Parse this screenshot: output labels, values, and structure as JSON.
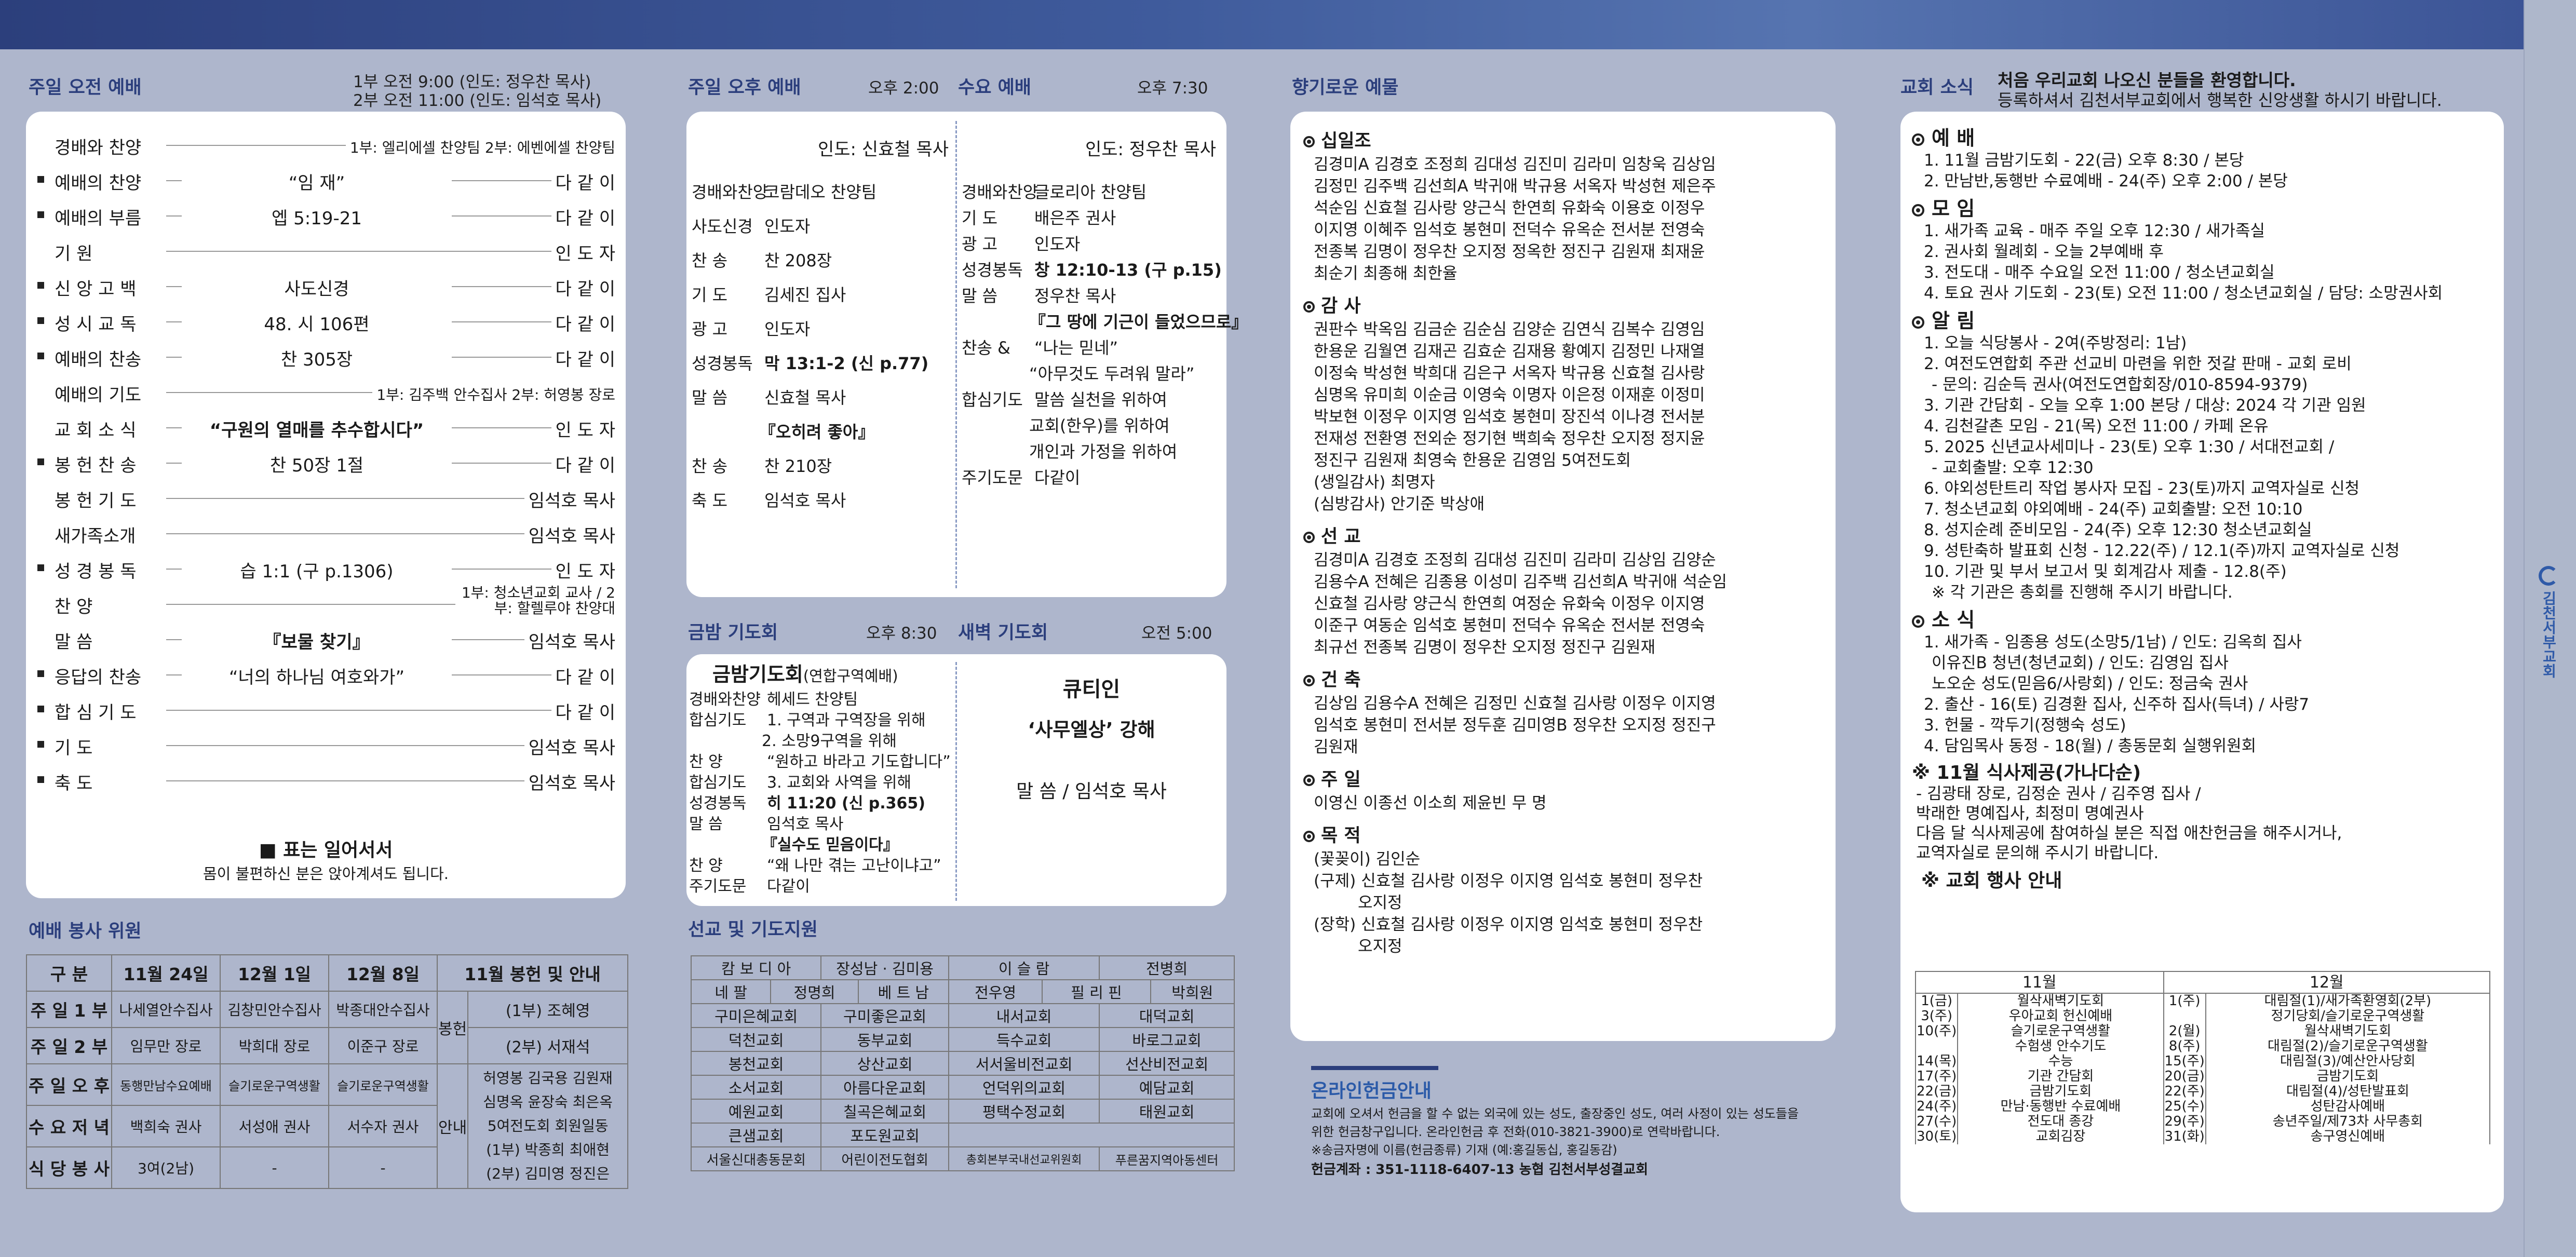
{
  "morning": {
    "title": "주일 오전 예배",
    "time1": "1부 오전  9:00 (인도: 정우찬 목사)",
    "time2": "2부 오전 11:00 (인도: 임석호 목사)",
    "rows": [
      {
        "l": "경배와 찬양",
        "m": "",
        "r": "1부: 엘리에셀 찬양팀 2부: 에벤에셀 찬양팀"
      },
      {
        "l": "예배의 찬양",
        "m": "“임 재”",
        "r": "다 같 이"
      },
      {
        "l": "예배의 부름",
        "m": "엡 5:19-21",
        "r": "다 같 이"
      },
      {
        "l": "기          원",
        "m": "",
        "r": "인 도 자"
      },
      {
        "l": "신 앙 고 백",
        "m": "사도신경",
        "r": "다 같 이"
      },
      {
        "l": "성 시 교 독",
        "m": "48. 시 106편",
        "r": "다 같 이"
      },
      {
        "l": "예배의 찬송",
        "m": "찬 305장",
        "r": "다 같 이"
      },
      {
        "l": "예배의 기도",
        "m": "",
        "r": "1부: 김주백 안수집사 2부: 허영봉 장로"
      },
      {
        "l": "교 회 소 식",
        "m": "“구원의 열매를 추수합시다”",
        "r": "인 도 자"
      },
      {
        "l": "봉 헌 찬 송",
        "m": "찬 50장 1절",
        "r": "다 같 이"
      },
      {
        "l": "봉 헌 기 도",
        "m": "",
        "r": "임석호 목사"
      },
      {
        "l": "새가족소개",
        "m": "",
        "r": "임석호 목사"
      },
      {
        "l": "성 경 봉 독",
        "m": "습 1:1 (구 p.1306)",
        "r": "인 도 자"
      },
      {
        "l": "찬          양",
        "m": "",
        "r": "1부: 청소년교회 교사 / 2부: 할렐루야 찬양대"
      },
      {
        "l": "말          씀",
        "m": "『보물 찾기』",
        "r": "임석호 목사"
      },
      {
        "l": "응답의 찬송",
        "m": "“너의 하나님 여호와가”",
        "r": "다 같 이"
      },
      {
        "l": "합 심 기 도",
        "m": "",
        "r": "다 같 이"
      },
      {
        "l": "기          도",
        "m": "",
        "r": "임석호 목사"
      },
      {
        "l": "축          도",
        "m": "",
        "r": "임석호 목사"
      }
    ],
    "note1": "■ 표는 일어서서",
    "note2": "몸이 불편하신 분은 앉아계셔도 됩니다."
  },
  "service": {
    "title": "예배 봉사 위원",
    "headers": [
      "구 분",
      "11월 24일",
      "12월 1일",
      "12월 8일",
      "11월 봉헌 및 안내"
    ],
    "rows": [
      [
        "주 일 1 부",
        "나세열안수집사",
        "김창민안수집사",
        "박종대안수집사"
      ],
      [
        "주 일 2 부",
        "임무만 장로",
        "박희대 장로",
        "이준구 장로"
      ],
      [
        "주 일 오 후",
        "동행만남수요예배",
        "슬기로운구역생활",
        "슬기로운구역생활"
      ],
      [
        "수 요 저 녁",
        "백희숙 권사",
        "서성애 권사",
        "서수자 권사"
      ],
      [
        "식 당 봉 사",
        "3여(2남)",
        "-",
        "-"
      ]
    ],
    "offer_label1": "봉헌",
    "offer_label2": "안내",
    "offer1": "(1부) 조혜영",
    "offer2": "(2부) 서재석",
    "guide": [
      "허영봉 김국용 김원재",
      "심명옥 윤장숙 최은옥",
      "5여전도회 회원일동",
      "(1부) 박종희 최애현",
      "(2부) 김미영 정진은"
    ]
  },
  "afternoon": {
    "title": "주일 오후 예배",
    "time": "오후 2:00",
    "leader": "인도: 신효철 목사",
    "rows": [
      [
        "경배와찬양",
        "코람데오 찬양팀"
      ],
      [
        "사도신경",
        "인도자"
      ],
      [
        "찬      송",
        "찬 208장"
      ],
      [
        "기      도",
        "김세진 집사"
      ],
      [
        "광      고",
        "인도자"
      ],
      [
        "성경봉독",
        "막 13:1-2 (신 p.77)"
      ],
      [
        "말      씀",
        "신효철 목사"
      ],
      [
        "",
        "『오히려 좋아』"
      ],
      [
        "찬      송",
        "찬 210장"
      ],
      [
        "축      도",
        "임석호 목사"
      ]
    ]
  },
  "wednesday": {
    "title": "수요 예배",
    "time": "오후 7:30",
    "leader": "인도: 정우찬 목사",
    "rows": [
      [
        "경배와찬양",
        "글로리아 찬양팀"
      ],
      [
        "기      도",
        "배은주 권사"
      ],
      [
        "광      고",
        "인도자"
      ],
      [
        "성경봉독",
        "창 12:10-13 (구 p.15)"
      ],
      [
        "말      씀",
        "정우찬 목사"
      ],
      [
        "",
        "『그 땅에 기근이 들었으므로』"
      ],
      [
        "찬송 &",
        "“나는 믿네”"
      ],
      [
        "",
        "“아무것도 두려워 말라”"
      ],
      [
        "합심기도",
        "말씀 실천을 위하여"
      ],
      [
        "",
        "교회(한우)를 위하여"
      ],
      [
        "",
        "개인과 가정을 위하여"
      ],
      [
        "주기도문",
        "다같이"
      ]
    ]
  },
  "friday": {
    "title": "금밤 기도회",
    "time": "오후 8:30",
    "head": "금밤기도회",
    "head_sub": "(연합구역예배)",
    "rows": [
      [
        "경배와찬양",
        "헤세드 찬양팀"
      ],
      [
        "합심기도",
        "1. 구역과 구역장을 위해"
      ],
      [
        "",
        "2. 소망9구역을 위해"
      ],
      [
        "찬      양",
        "“원하고 바라고 기도합니다”"
      ],
      [
        "합심기도",
        "3. 교회와 사역을 위해"
      ],
      [
        "성경봉독",
        "히 11:20 (신 p.365)"
      ],
      [
        "말      씀",
        "임석호 목사"
      ],
      [
        "",
        "『실수도 믿음이다』"
      ],
      [
        "찬      양",
        "“왜 나만 겪는 고난이냐고”"
      ],
      [
        "주기도문",
        "다같이"
      ]
    ]
  },
  "dawn": {
    "title": "새벽 기도회",
    "time": "오전 5:00",
    "head": "큐티인",
    "sub": "‘사무엘상’ 강해",
    "speaker": "말 씀 / 임석호 목사"
  },
  "mission": {
    "title": "선교 및 기도지원",
    "rows": [
      [
        "캄 보 디 아",
        "장성남 · 김미용",
        "이 슬 람",
        "전병희"
      ],
      [
        "네 팔",
        "정명희",
        "베 트 남",
        "전우영",
        "필 리 핀",
        "박희원"
      ],
      [
        "구미은혜교회",
        "구미좋은교회",
        "내서교회",
        "대덕교회"
      ],
      [
        "덕천교회",
        "동부교회",
        "득수교회",
        "바로그교회"
      ],
      [
        "봉천교회",
        "상산교회",
        "서서울비전교회",
        "선산비전교회"
      ],
      [
        "소서교회",
        "아름다운교회",
        "언덕위의교회",
        "예담교회"
      ],
      [
        "예원교회",
        "칠곡은혜교회",
        "평택수정교회",
        "태원교회"
      ],
      [
        "큰샘교회",
        "포도원교회"
      ],
      [
        "서울신대총동문회",
        "어린이전도협회",
        "총회본부국내선교위원회",
        "푸른꿈지역아동센터"
      ]
    ]
  },
  "prayer": {
    "title": "향기로운 예물",
    "sections": [
      {
        "h": "십일조",
        "lines": [
          "김경미A 김경호 조정희 김대성 김진미 김라미 임창욱 김상임",
          "김정민 김주백 김선희A 박귀애 박규용 서옥자 박성현 제은주",
          "석순임 신효철 김사랑 양근식 한연희 유화숙 이용호 이정우",
          "이지영 이혜주 임석호 봉현미 전덕수 유옥순 전서분 전영숙",
          "전종복 김명이 정우찬 오지정 정옥한 정진구 김원재 최재윤",
          "최순기 최종해 최한율"
        ]
      },
      {
        "h": "감 사",
        "lines": [
          "권판수 박옥임 김금순 김순심 김양순 김연식 김복수 김영임",
          "한용운 김월연 김재곤 김효순 김재용 황예지 김정민 나재열",
          "이정숙 박성현 박희대 김은구 서옥자 박규용 신효철 김사랑",
          "심명옥 유미희 이순금 이영숙 이명자 이은정 이재훈 이정미",
          "박보현 이정우 이지영 임석호 봉현미 장진석 이나경 전서분",
          "전재성 전환영 전외순 정기현 백희숙 정우찬 오지정 정지윤",
          "정진구 김원재 최영숙 한용운 김영임 5여전도회",
          "(생일감사) 최명자",
          "(심방감사) 안기준 박상애"
        ]
      },
      {
        "h": "선 교",
        "lines": [
          "김경미A 김경호 조정희 김대성 김진미 김라미 김상임 김양순",
          "김용수A 전혜은 김종용 이성미 김주백 김선희A 박귀애 석순임",
          "신효철 김사랑 양근식 한연희 여정순 유화숙 이정우 이지영",
          "이준구 여동순 임석호 봉현미 전덕수 유옥순 전서분 전영숙",
          "최규선 전종복 김명이 정우찬 오지정 정진구 김원재"
        ]
      },
      {
        "h": "건 축",
        "lines": [
          "김상임 김용수A 전혜은 김정민 신효철 김사랑 이정우 이지영",
          "임석호 봉현미 전서분 정두훈 김미영B 정우찬 오지정 정진구",
          "김원재"
        ]
      },
      {
        "h": "주 일",
        "lines": [
          "이영신 이종선 이소희 제윤빈 무   명"
        ]
      },
      {
        "h": "목 적",
        "lines": [
          "(꽃꽂이) 김인순",
          "(구제) 신효철 김사랑 이정우 이지영 임석호 봉현미 정우찬",
          "오지정",
          "(장학) 신효철 김사랑 이정우 이지영 임석호 봉현미 정우찬",
          "오지정"
        ]
      }
    ],
    "online_title": "온라인헌금안내",
    "online1": "교회에 오셔서 헌금을 할 수 없는 외국에 있는 성도, 출장중인 성도, 여러 사정이 있는 성도들을",
    "online2": "위한 헌금창구입니다. 온라인헌금 후 전화(010-3821-3900)로 연락바랍니다.",
    "online3": "※송금자명에 이름(헌금종류) 기재 (예:홍길동십, 홍길동감)",
    "online4": "헌금계좌 : 351-1118-6407-13 농협 김천서부성결교회"
  },
  "news": {
    "title": "교회 소식",
    "welcome1": "처음 우리교회 나오신 분들을 환영합니다.",
    "welcome2": "등록하셔서 김천서부교회에서 행복한 신앙생활 하시기 바랍니다.",
    "sec_worship": "예  배",
    "worship": [
      "1. 11월 금밤기도회 - 22(금) 오후 8:30 / 본당",
      "2. 만남반,동행반 수료예배 - 24(주) 오후 2:00 / 본당"
    ],
    "sec_meet": "모  임",
    "meet": [
      "1. 새가족 교육 - 매주 주일 오후 12:30 / 새가족실",
      "2. 권사회 월례회 - 오늘 2부예배 후",
      "3. 전도대 - 매주 수요일 오전 11:00 / 청소년교회실",
      "4. 토요 권사 기도회 - 23(토) 오전 11:00 / 청소년교회실 / 담당: 소망권사회"
    ],
    "sec_notice": "알  림",
    "notice": [
      "1. 오늘 식당봉사 - 2여(주방정리: 1남)",
      "2. 여전도연합회 주관 선교비 마련을 위한 젓갈 판매 - 교회 로비",
      "   - 문의: 김순득 권사(여전도연합회장/010-8594-9379)",
      "3. 기관 간담회 - 오늘 오후 1:00 본당 / 대상: 2024 각 기관 임원",
      "4. 김천갈촌 모임 - 21(목) 오전 11:00 / 카페 온유",
      "5. 2025 신년교사세미나 - 23(토) 오후 1:30 / 서대전교회 /",
      "   - 교회출발: 오후 12:30",
      "6. 야외성탄트리 작업 봉사자 모집 - 23(토)까지 교역자실로 신청",
      "7. 청소년교회 야외예배 - 24(주) 교회출발: 오전 10:10",
      "8. 성지순례 준비모임 - 24(주) 오후 12:30 청소년교회실",
      "9. 성탄축하 발표회 신청 - 12.22(주) / 12.1(주)까지 교역자실로 신청",
      "10. 기관 및 부서 보고서 및 회계감사 제출 - 12.8(주)",
      "   ※ 각 기관은 총회를 진행해 주시기 바랍니다."
    ],
    "sec_news": "소  식",
    "newsitems": [
      "1. 새가족 - 임종용 성도(소망5/1남) / 인도: 김옥희 집사",
      "            이유진B 청년(청년교회) / 인도: 김영임 집사",
      "            노오순 성도(믿음6/사랑회) / 인도: 정금숙 권사",
      "2. 출산 - 16(토) 김경환 집사, 신주하 집사(득녀) / 사랑7",
      "3. 헌물 - 깍두기(정행숙 성도)",
      "4. 담임목사 동정 - 18(월) / 총동문회 실행위원회"
    ],
    "meal_title": "※ 11월 식사제공(가나다순)",
    "meal": [
      "- 김광태 장로, 김정순 권사 / 김주영 집사 /",
      "  박래한 명예집사, 최정미 명예권사",
      "다음 달 식사제공에 참여하실 분은 직접 애찬헌금을 해주시거나,",
      "교역자실로 문의해 주시기 바랍니다."
    ],
    "event_title": "※ 교회 행사 안내",
    "event_month1": "11월",
    "event_month2": "12월",
    "events": [
      [
        "1(금)",
        "월삭새벽기도회",
        "1(주)",
        "대림절(1)/새가족환영회(2부)"
      ],
      [
        "3(주)",
        "우아교회 헌신예배",
        "",
        "정기당회/슬기로운구역생활"
      ],
      [
        "10(주)",
        "슬기로운구역생활",
        "2(월)",
        "월삭새벽기도회"
      ],
      [
        "",
        "수험생 안수기도",
        "8(주)",
        "대림절(2)/슬기로운구역생활"
      ],
      [
        "14(목)",
        "수능",
        "15(주)",
        "대림절(3)/예산안사당회"
      ],
      [
        "17(주)",
        "기관 간담회",
        "20(금)",
        "금밤기도회"
      ],
      [
        "22(금)",
        "금밤기도회",
        "22(주)",
        "대림절(4)/성탄발표회"
      ],
      [
        "24(주)",
        "만남·동행반 수료예배",
        "25(수)",
        "성탄감사예배"
      ],
      [
        "27(수)",
        "전도대 종강",
        "29(주)",
        "송년주일/제73차 사무총회"
      ],
      [
        "30(토)",
        "교회김장",
        "31(화)",
        "송구영신예배"
      ]
    ]
  },
  "logo_text": "김천서부교회"
}
